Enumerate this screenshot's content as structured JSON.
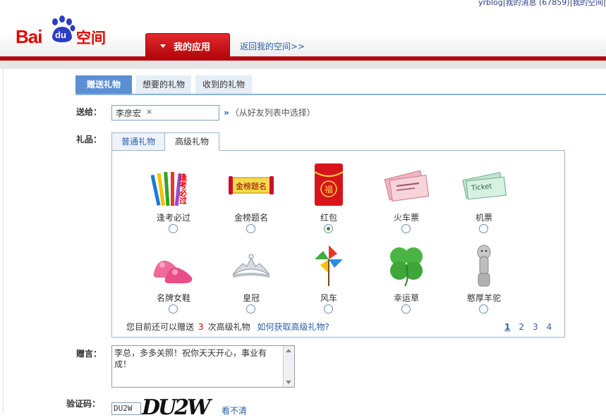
{
  "header": {
    "top_links": {
      "user": "yrblog",
      "messages": "我的消息 (67859)",
      "space": "我的空间"
    },
    "logo": {
      "bai": "Bai",
      "du": "du",
      "space": "空间"
    },
    "app_tab": "我的应用",
    "back_link": "返回我的空间>>"
  },
  "tabs": [
    "赠送礼物",
    "想要的礼物",
    "收到的礼物"
  ],
  "form": {
    "to_label": "送给：",
    "recipient": "李彦宏",
    "remove_icon": "×",
    "friend_link": "（从好友列表中选择）",
    "gift_label": "礼品：",
    "message_label": "赠言：",
    "message": "李总，多多关照！祝你天天开心，事业有成！",
    "captcha_label": "验证码：",
    "captcha_value": "DU2W",
    "captcha_image_text": "DU2W",
    "captcha_refresh": "看不清"
  },
  "gift_tabs": [
    "普通礼物",
    "高级礼物"
  ],
  "gifts": [
    {
      "name": "逢考必过",
      "icon": "pencils-icon",
      "selected": false
    },
    {
      "name": "金榜题名",
      "icon": "scroll-icon",
      "selected": false
    },
    {
      "name": "红包",
      "icon": "red-envelope-icon",
      "selected": true
    },
    {
      "name": "火车票",
      "icon": "train-ticket-icon",
      "selected": false
    },
    {
      "name": "机票",
      "icon": "plane-ticket-icon",
      "selected": false
    },
    {
      "name": "名牌女鞋",
      "icon": "shoes-icon",
      "selected": false
    },
    {
      "name": "皇冠",
      "icon": "crown-icon",
      "selected": false
    },
    {
      "name": "风车",
      "icon": "pinwheel-icon",
      "selected": false
    },
    {
      "name": "幸运草",
      "icon": "clover-icon",
      "selected": false
    },
    {
      "name": "憨厚羊驼",
      "icon": "alpaca-icon",
      "selected": false
    }
  ],
  "gift_image_text": {
    "exam": "逢考必过",
    "scroll": "金榜题名",
    "envelope": "福",
    "ticket": "Ticket"
  },
  "quota": {
    "prefix": "您目前还可以赠送",
    "count": "3",
    "suffix": "次高级礼物",
    "how_link": "如何获取高级礼物?"
  },
  "pager": [
    "1",
    "2",
    "3",
    "4"
  ],
  "colors": {
    "brand_red": "#e10600",
    "tab_blue": "#5b8fd4",
    "link_blue": "#2b5fa5"
  }
}
